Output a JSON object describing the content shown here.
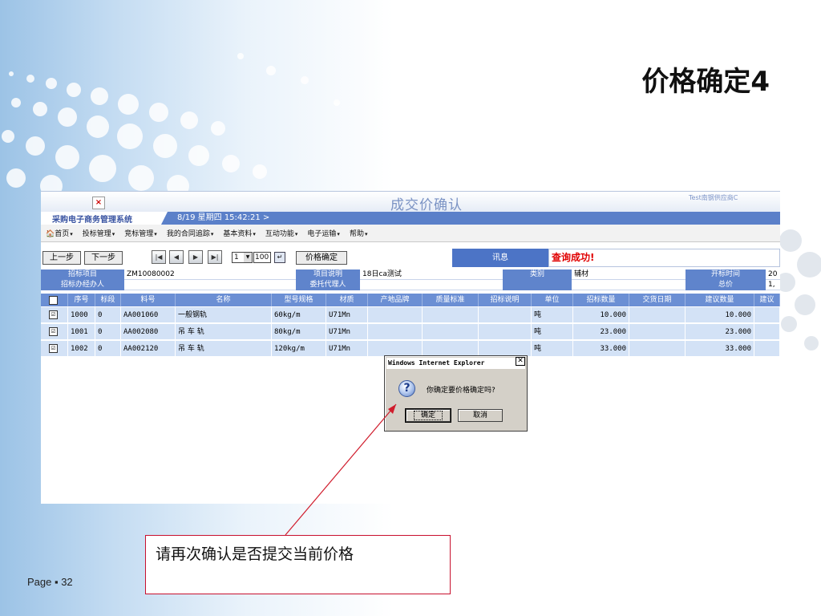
{
  "slide": {
    "title": "价格确定4",
    "footer": "Page ▪ 32",
    "callout": "请再次确认是否提交当前价格",
    "colors": {
      "callout_border": "#c8102e",
      "grid_header": "#6b8fd4",
      "grid_row": "#d3e2f6",
      "status_ok": "#e00000"
    }
  },
  "app": {
    "page_title": "成交价确认",
    "user": "Test南钢供应商C",
    "system_name": "采购电子商务管理系统",
    "datetime": "8/19 星期四  15:42:21 >",
    "menu": [
      {
        "label": "首页",
        "icon": "home-icon"
      },
      {
        "label": "投标管理"
      },
      {
        "label": "竞标管理"
      },
      {
        "label": "我的合同追踪"
      },
      {
        "label": "基本资料"
      },
      {
        "label": "互动功能"
      },
      {
        "label": "电子运输"
      },
      {
        "label": "帮助"
      }
    ],
    "menu_arrow": "▾",
    "toolbar": {
      "prev": "上一步",
      "next": "下一步",
      "first_icon": "first-page-icon",
      "prev_page_icon": "prev-page-icon",
      "next_page_icon": "next-page-icon",
      "last_page_icon": "last-page-icon",
      "page_number": "1",
      "page_size": "100",
      "confirm_price": "价格确定",
      "message_label": "讯息",
      "message_value": "查询成功!"
    },
    "info": {
      "project_label": "招标项目",
      "project_value": "ZM10080002",
      "desc_label": "项目说明",
      "desc_value": "18日ca测试",
      "category_label": "类别",
      "category_value": "辅材",
      "open_time_label": "开标时间",
      "open_time_value": "20",
      "handler_label": "招标办经办人",
      "handler_value": "",
      "agent_label": "委托代理人",
      "agent_value": "",
      "total_label": "总价",
      "total_value": "1,"
    },
    "grid": {
      "headers": [
        "序号",
        "标段",
        "料号",
        "名称",
        "型号规格",
        "材质",
        "产地品牌",
        "质量标准",
        "招标说明",
        "单位",
        "招标数量",
        "交货日期",
        "建议数量",
        "建议"
      ],
      "rows": [
        {
          "checked": "☑",
          "seq": "1000",
          "section": "0",
          "code": "AA001060",
          "name": "一般钢轨",
          "spec": "60kg/m",
          "material": "U71Mn",
          "origin": "",
          "quality": "",
          "note": "",
          "unit": "吨",
          "qty": "10.000",
          "delivery": "",
          "suggest_qty": "10.000",
          "suggest": ""
        },
        {
          "checked": "☑",
          "seq": "1001",
          "section": "0",
          "code": "AA002080",
          "name": "吊 车 轨",
          "spec": "80kg/m",
          "material": "U71Mn",
          "origin": "",
          "quality": "",
          "note": "",
          "unit": "吨",
          "qty": "23.000",
          "delivery": "",
          "suggest_qty": "23.000",
          "suggest": ""
        },
        {
          "checked": "☑",
          "seq": "1002",
          "section": "0",
          "code": "AA002120",
          "name": "吊 车 轨",
          "spec": "120kg/m",
          "material": "U71Mn",
          "origin": "",
          "quality": "",
          "note": "",
          "unit": "吨",
          "qty": "33.000",
          "delivery": "",
          "suggest_qty": "33.000",
          "suggest": ""
        }
      ]
    }
  },
  "dialog": {
    "title": "Windows Internet Explorer",
    "close": "✕",
    "icon": "question-icon",
    "message": "你确定要价格确定吗?",
    "ok": "确定",
    "cancel": "取消"
  }
}
